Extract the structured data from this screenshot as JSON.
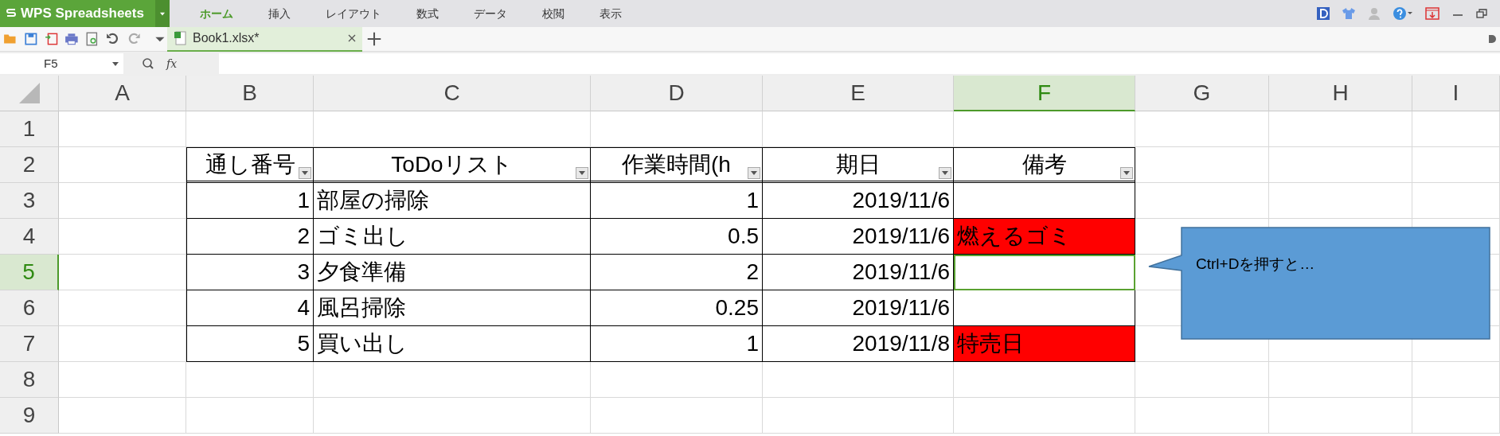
{
  "app": {
    "title": "WPS Spreadsheets"
  },
  "ribbon_tabs": [
    {
      "label": "ホーム",
      "selected": true
    },
    {
      "label": "挿入",
      "selected": false
    },
    {
      "label": "レイアウト",
      "selected": false
    },
    {
      "label": "数式",
      "selected": false
    },
    {
      "label": "データ",
      "selected": false
    },
    {
      "label": "校閲",
      "selected": false
    },
    {
      "label": "表示",
      "selected": false
    }
  ],
  "document_tabs": [
    {
      "label": "Book1.xlsx*",
      "selected": true
    }
  ],
  "formula_bar": {
    "name_box": "F5",
    "fx": "fx"
  },
  "sheet": {
    "columns": [
      {
        "label": "A",
        "selected": false
      },
      {
        "label": "B",
        "selected": false
      },
      {
        "label": "C",
        "selected": false
      },
      {
        "label": "D",
        "selected": false
      },
      {
        "label": "E",
        "selected": false
      },
      {
        "label": "F",
        "selected": true
      },
      {
        "label": "G",
        "selected": false
      },
      {
        "label": "H",
        "selected": false
      },
      {
        "label": "I",
        "selected": false
      }
    ],
    "rows": [
      {
        "label": "1",
        "selected": false
      },
      {
        "label": "2",
        "selected": false
      },
      {
        "label": "3",
        "selected": false
      },
      {
        "label": "4",
        "selected": false
      },
      {
        "label": "5",
        "selected": true
      },
      {
        "label": "6",
        "selected": false
      },
      {
        "label": "7",
        "selected": false
      },
      {
        "label": "8",
        "selected": false
      },
      {
        "label": "9",
        "selected": false
      }
    ]
  },
  "table": {
    "headers": [
      {
        "text": "通し番号",
        "filter": true
      },
      {
        "text": "ToDoリスト",
        "filter": true
      },
      {
        "text": "作業時間(h",
        "filter": true
      },
      {
        "text": "期日",
        "filter": true
      },
      {
        "text": "備考",
        "filter": true
      }
    ],
    "rows": [
      {
        "cells": [
          {
            "text": "1",
            "kind": "number",
            "selected": false
          },
          {
            "text": "部屋の掃除",
            "kind": "text",
            "selected": false
          },
          {
            "text": "1",
            "kind": "number",
            "selected": false
          },
          {
            "text": "2019/11/6",
            "kind": "number",
            "selected": false
          },
          {
            "kind": "text",
            "selected": false
          }
        ]
      },
      {
        "cells": [
          {
            "text": "2",
            "kind": "number",
            "selected": false
          },
          {
            "text": "ゴミ出し",
            "kind": "text",
            "selected": false
          },
          {
            "text": "0.5",
            "kind": "number",
            "selected": false
          },
          {
            "text": "2019/11/6",
            "kind": "number",
            "selected": false
          },
          {
            "text": "燃えるゴミ",
            "kind": "text",
            "selected": false,
            "color": "#ff0000"
          }
        ]
      },
      {
        "cells": [
          {
            "text": "3",
            "kind": "number",
            "selected": false
          },
          {
            "text": "夕食準備",
            "kind": "text",
            "selected": false
          },
          {
            "text": "2",
            "kind": "number",
            "selected": false
          },
          {
            "text": "2019/11/6",
            "kind": "number",
            "selected": false
          },
          {
            "kind": "text",
            "selected": true
          }
        ]
      },
      {
        "cells": [
          {
            "text": "4",
            "kind": "number",
            "selected": false
          },
          {
            "text": "風呂掃除",
            "kind": "text",
            "selected": false
          },
          {
            "text": "0.25",
            "kind": "number",
            "selected": false
          },
          {
            "text": "2019/11/6",
            "kind": "number",
            "selected": false
          },
          {
            "kind": "text",
            "selected": false
          }
        ]
      },
      {
        "cells": [
          {
            "text": "5",
            "kind": "number",
            "selected": false
          },
          {
            "text": "買い出し",
            "kind": "text",
            "selected": false
          },
          {
            "text": "1",
            "kind": "number",
            "selected": false
          },
          {
            "text": "2019/11/8",
            "kind": "number",
            "selected": false
          },
          {
            "text": "特売日",
            "kind": "text",
            "selected": false,
            "color": "#ff0000"
          }
        ]
      }
    ]
  },
  "callout": {
    "text": "Ctrl+Dを押すと…"
  }
}
